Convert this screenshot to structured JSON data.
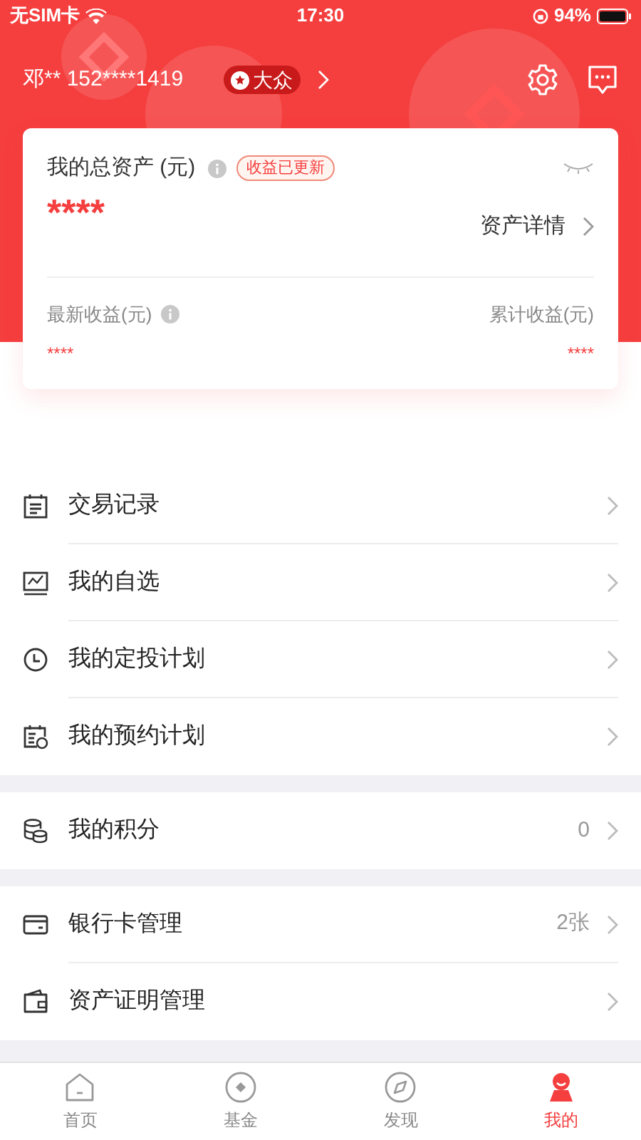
{
  "status_bar": {
    "carrier": "无SIM卡",
    "time": "17:30",
    "battery": "94%"
  },
  "header": {
    "user": "邓** 152****1419",
    "level_badge": "大众"
  },
  "assets_card": {
    "title": "我的总资产 (元)",
    "badge": "收益已更新",
    "total": "****",
    "detail_link": "资产详情",
    "latest_label": "最新收益(元)",
    "latest_value": "****",
    "cumulative_label": "累计收益(元)",
    "cumulative_value": "****"
  },
  "menu_groups": [
    [
      {
        "label": "交易记录"
      },
      {
        "label": "我的自选"
      },
      {
        "label": "我的定投计划"
      },
      {
        "label": "我的预约计划"
      }
    ],
    [
      {
        "label": "我的积分",
        "value": "0"
      }
    ],
    [
      {
        "label": "银行卡管理",
        "value": "2张"
      },
      {
        "label": "资产证明管理"
      }
    ]
  ],
  "tabs": [
    {
      "label": "首页",
      "selected": false
    },
    {
      "label": "基金",
      "selected": false
    },
    {
      "label": "发现",
      "selected": false
    },
    {
      "label": "我的",
      "selected": true
    }
  ]
}
